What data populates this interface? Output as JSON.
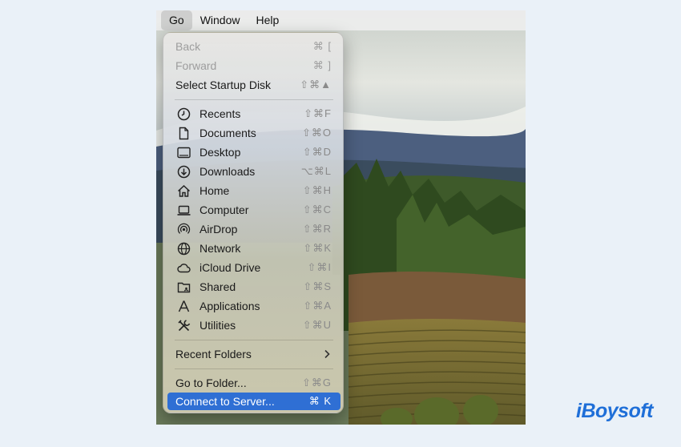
{
  "menubar": {
    "items": [
      {
        "label": "Go",
        "active": true
      },
      {
        "label": "Window",
        "active": false
      },
      {
        "label": "Help",
        "active": false
      }
    ]
  },
  "go_menu": {
    "items": [
      {
        "label": "Back",
        "shortcut": "⌘ [",
        "disabled": true
      },
      {
        "label": "Forward",
        "shortcut": "⌘ ]",
        "disabled": true
      },
      {
        "label": "Select Startup Disk",
        "shortcut": "⇧⌘▲"
      },
      {
        "label": "Recents",
        "shortcut": "⇧⌘F",
        "icon": "clock-icon"
      },
      {
        "label": "Documents",
        "shortcut": "⇧⌘O",
        "icon": "document-icon"
      },
      {
        "label": "Desktop",
        "shortcut": "⇧⌘D",
        "icon": "desktop-icon"
      },
      {
        "label": "Downloads",
        "shortcut": "⌥⌘L",
        "icon": "download-icon"
      },
      {
        "label": "Home",
        "shortcut": "⇧⌘H",
        "icon": "home-icon"
      },
      {
        "label": "Computer",
        "shortcut": "⇧⌘C",
        "icon": "laptop-icon"
      },
      {
        "label": "AirDrop",
        "shortcut": "⇧⌘R",
        "icon": "airdrop-icon"
      },
      {
        "label": "Network",
        "shortcut": "⇧⌘K",
        "icon": "globe-icon"
      },
      {
        "label": "iCloud Drive",
        "shortcut": "⇧⌘I",
        "icon": "cloud-icon"
      },
      {
        "label": "Shared",
        "shortcut": "⇧⌘S",
        "icon": "shared-folder-icon"
      },
      {
        "label": "Applications",
        "shortcut": "⇧⌘A",
        "icon": "applications-icon"
      },
      {
        "label": "Utilities",
        "shortcut": "⇧⌘U",
        "icon": "tools-icon"
      },
      {
        "label": "Recent Folders",
        "submenu": true
      },
      {
        "label": "Go to Folder...",
        "shortcut": "⇧⌘G"
      },
      {
        "label": "Connect to Server...",
        "shortcut": "⌘ K",
        "selected": true
      }
    ]
  },
  "brand": {
    "logo_text": "iBoysoft",
    "color": "#1f6fd8"
  },
  "colors": {
    "selection": "#2f6fd4",
    "background": "#eaf1f8"
  }
}
